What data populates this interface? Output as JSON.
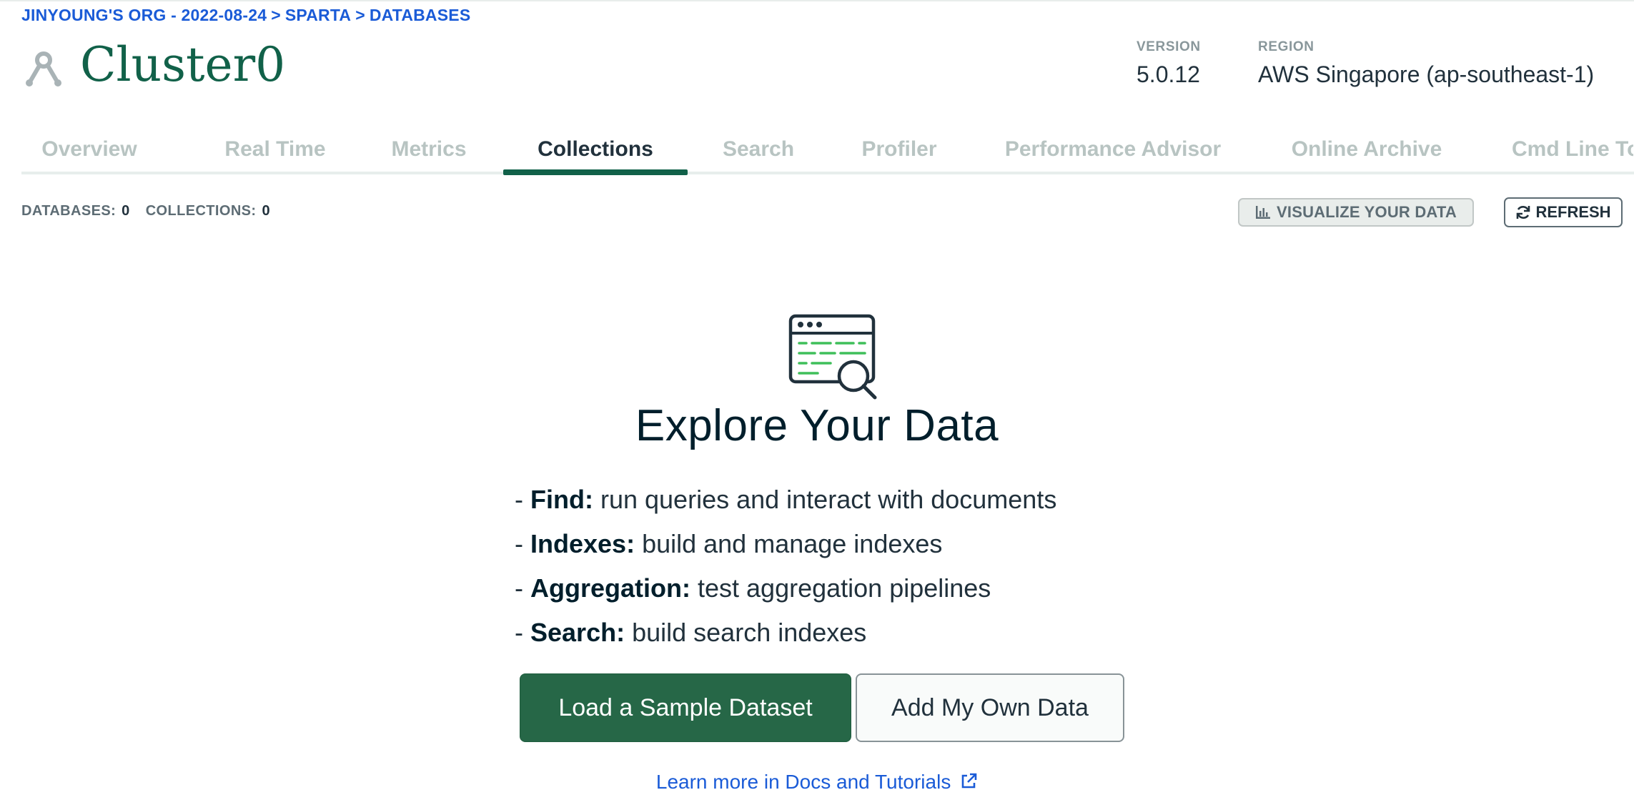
{
  "breadcrumb": {
    "org": "JINYOUNG'S ORG - 2022-08-24",
    "project": "SPARTA",
    "section": "DATABASES",
    "separator": ">"
  },
  "cluster": {
    "name": "Cluster0",
    "icon": "cluster-icon"
  },
  "meta": {
    "version_label": "VERSION",
    "version_value": "5.0.12",
    "region_label": "REGION",
    "region_value": "AWS Singapore (ap-southeast-1)"
  },
  "tabs": [
    {
      "label": "Overview"
    },
    {
      "label": "Real Time"
    },
    {
      "label": "Metrics"
    },
    {
      "label": "Collections",
      "active": true
    },
    {
      "label": "Search"
    },
    {
      "label": "Profiler"
    },
    {
      "label": "Performance Advisor"
    },
    {
      "label": "Online Archive"
    },
    {
      "label": "Cmd Line To"
    }
  ],
  "stats": {
    "databases_label": "DATABASES:",
    "databases_value": "0",
    "collections_label": "COLLECTIONS:",
    "collections_value": "0"
  },
  "toolbar": {
    "visualize_label": "VISUALIZE YOUR DATA",
    "visualize_icon": "bar-chart-icon",
    "refresh_label": "REFRESH",
    "refresh_icon": "refresh-icon"
  },
  "empty_state": {
    "icon": "browser-search-icon",
    "title": "Explore Your Data",
    "features": [
      {
        "prefix": "- ",
        "term": "Find:",
        "desc": "run queries and interact with documents"
      },
      {
        "prefix": "- ",
        "term": "Indexes:",
        "desc": "build and manage indexes"
      },
      {
        "prefix": "- ",
        "term": "Aggregation:",
        "desc": "test aggregation pipelines"
      },
      {
        "prefix": "- ",
        "term": "Search:",
        "desc": "build search indexes"
      }
    ],
    "primary_button": "Load a Sample Dataset",
    "secondary_button": "Add My Own Data",
    "learn_link": "Learn more in Docs and Tutorials",
    "learn_link_icon": "external-link-icon"
  },
  "colors": {
    "brand_green": "#116149",
    "button_green": "#266747",
    "link_blue": "#1a5bd7",
    "muted": "#b8c4c2"
  }
}
